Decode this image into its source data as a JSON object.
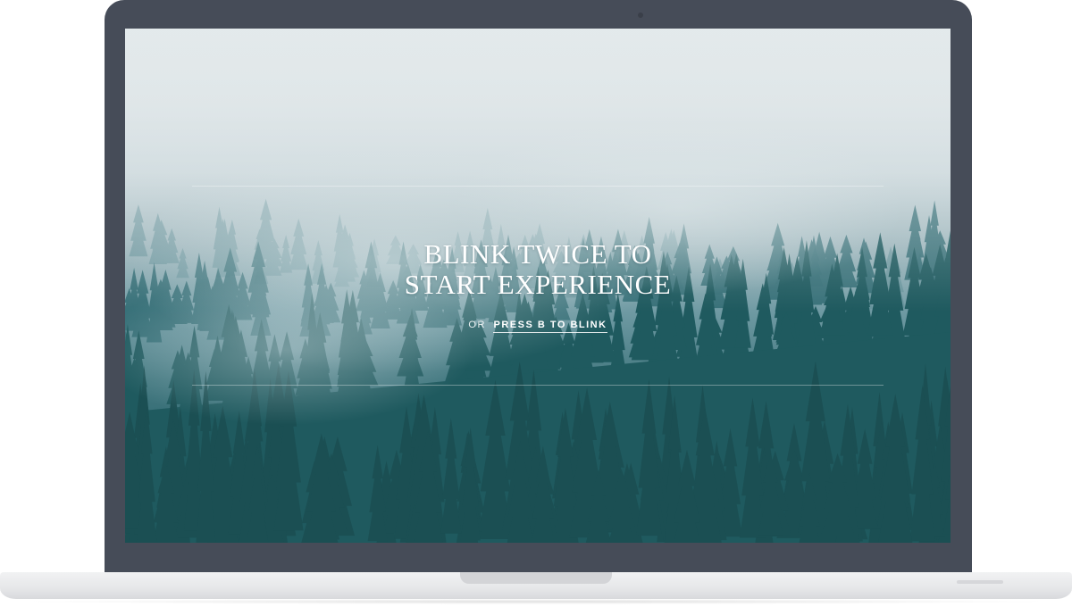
{
  "screen": {
    "headline_line1": "BLINK TWICE TO",
    "headline_line2": "START EXPERIENCE",
    "sub_or": "OR",
    "sub_link": "PRESS B TO BLINK"
  },
  "colors": {
    "bezel": "#464c58",
    "base": "#e6e7e9",
    "forest_dark": "#235c62",
    "fog": "#dfe6e8",
    "text": "#ffffff"
  },
  "background": {
    "subject": "misty-pine-forest"
  }
}
